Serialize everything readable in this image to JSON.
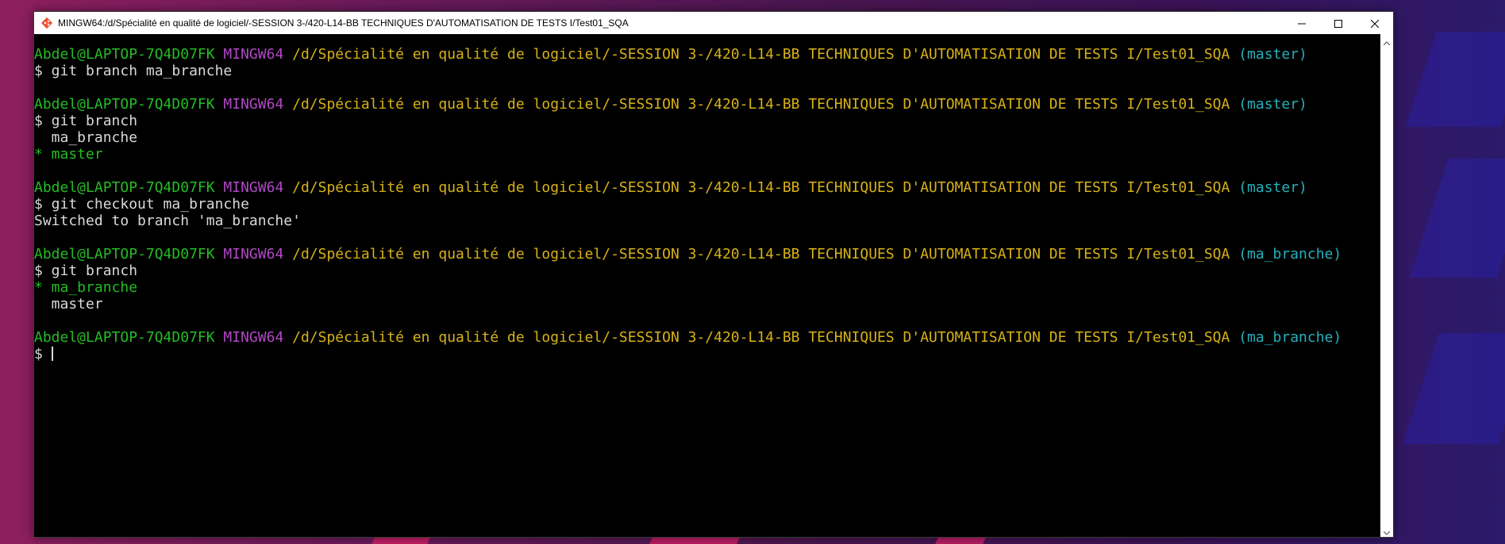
{
  "window": {
    "title": "MINGW64:/d/Spécialité en qualité de logiciel/-SESSION 3-/420-L14-BB TECHNIQUES D'AUTOMATISATION DE TESTS I/Test01_SQA",
    "icon": "git-bash-icon",
    "controls": [
      "minimize-icon",
      "maximize-icon",
      "close-icon"
    ]
  },
  "prompt": {
    "user": "Abdel@LAPTOP-7Q4D07FK",
    "host": "MINGW64",
    "path": "/d/Spécialité en qualité de logiciel/-SESSION 3-/420-L14-BB TECHNIQUES D'AUTOMATISATION DE TESTS I/Test01_SQA",
    "branch_master": "(master)",
    "branch_ma_branche": "(ma_branche)"
  },
  "session": {
    "cmd1": "$ git branch ma_branche",
    "cmd2": "$ git branch",
    "out2_a": "  ma_branche",
    "out2_b": "* master",
    "cmd3": "$ git checkout ma_branche",
    "out3": "Switched to branch 'ma_branche'",
    "cmd4": "$ git branch",
    "out4_a": "* ma_branche",
    "out4_b": "  master",
    "cmd5": "$ "
  },
  "colors": {
    "user": "#25bc24",
    "host": "#b148c6",
    "path": "#d8b217",
    "branch": "#25b0bc",
    "text": "#d9d9d9",
    "background": "#000000"
  }
}
